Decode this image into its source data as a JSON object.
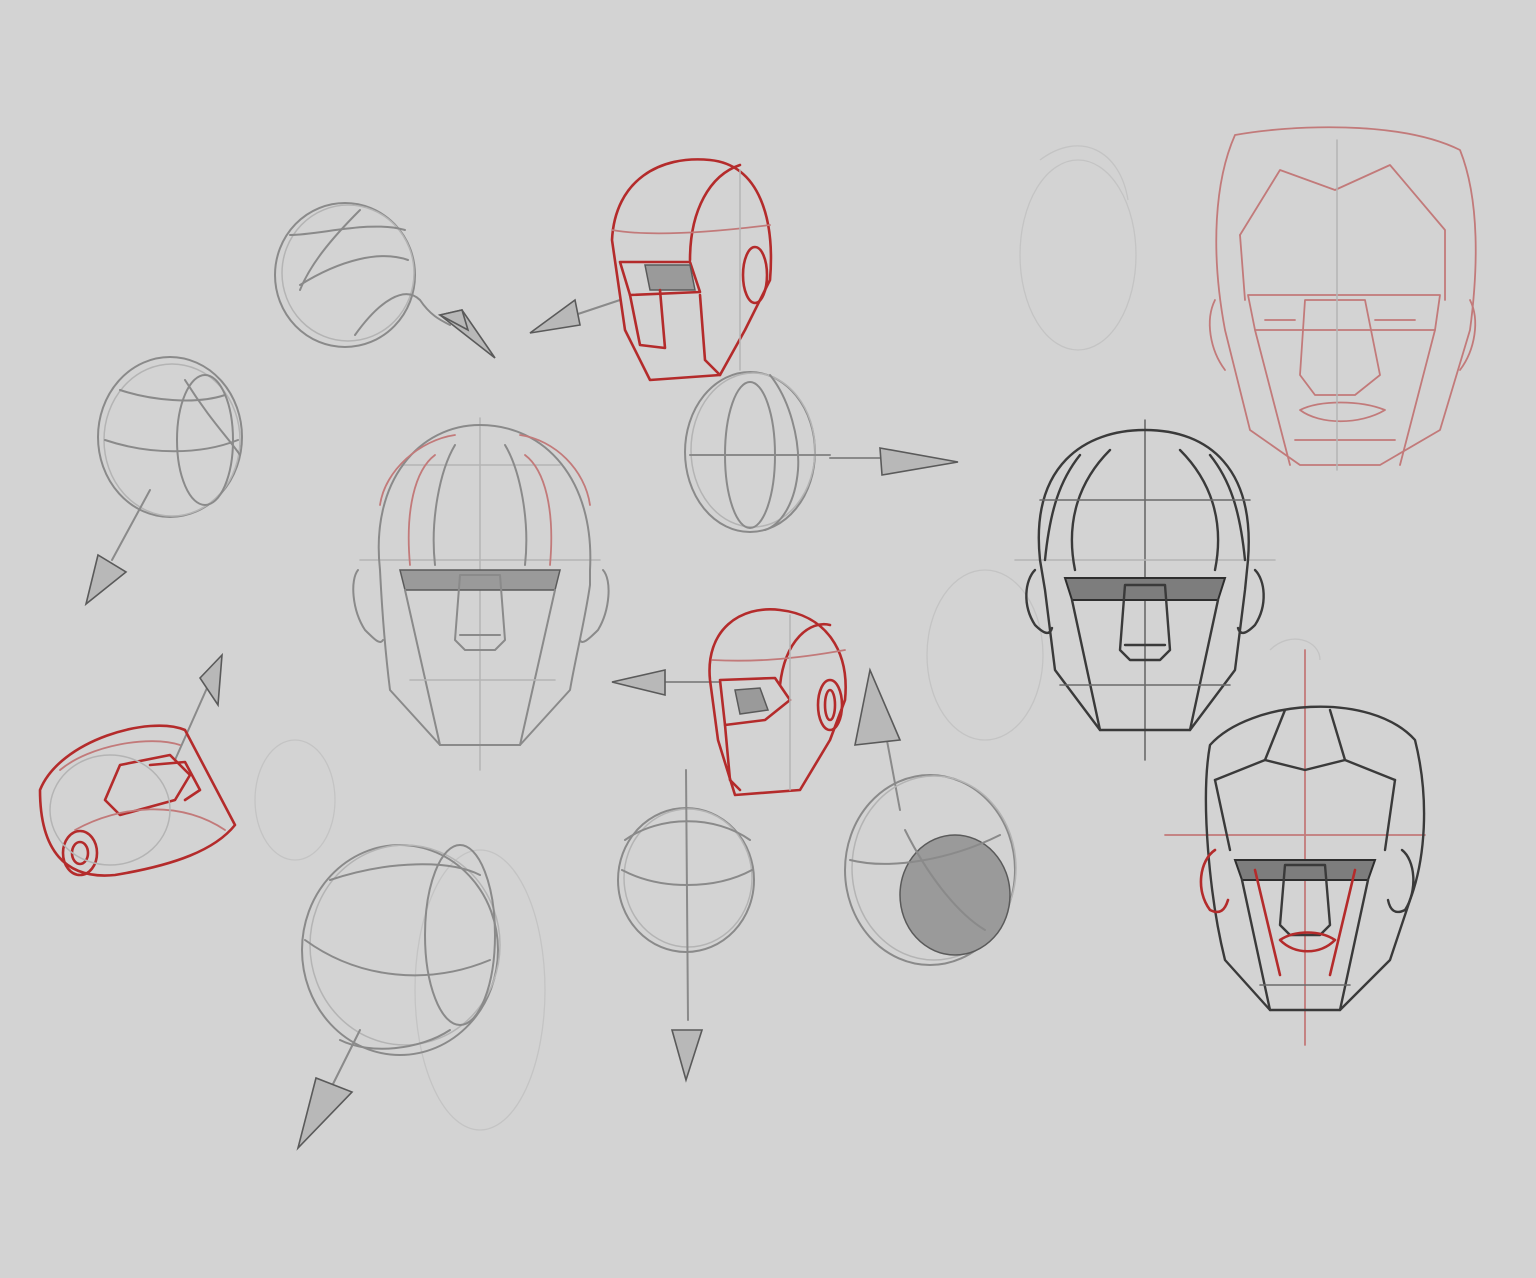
{
  "image": {
    "background_color": "#d3d3d3",
    "stroke_colors": {
      "graphite": "#8a8a8a",
      "red_pencil": "#b42b2b",
      "light_red": "#c27a7a",
      "dark_ink": "#3a3a3a"
    }
  }
}
